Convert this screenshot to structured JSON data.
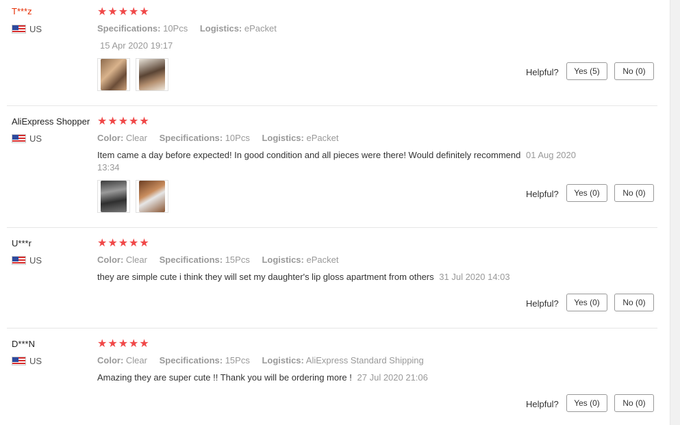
{
  "helpful_label": "Helpful?",
  "star_char": "★",
  "colors": {
    "star": "#f04848",
    "username_highlight": "#e62e04",
    "muted": "#999999"
  },
  "reviews": [
    {
      "user": "T***z",
      "country": "US",
      "rating": 5,
      "specs": [
        {
          "key": "Specifications:",
          "value": "10Pcs"
        },
        {
          "key": "Logistics:",
          "value": "ePacket"
        }
      ],
      "feedback": "",
      "date": "15 Apr 2020 19:17",
      "photos": [
        "photo",
        "photo"
      ],
      "yes": "Yes (5)",
      "no": "No (0)"
    },
    {
      "user": "AliExpress Shopper",
      "country": "US",
      "rating": 5,
      "specs": [
        {
          "key": "Color:",
          "value": "Clear"
        },
        {
          "key": "Specifications:",
          "value": "10Pcs"
        },
        {
          "key": "Logistics:",
          "value": "ePacket"
        }
      ],
      "feedback": "Item came a day before expected! In good condition and all pieces were there! Would definitely recommend",
      "date": "01 Aug 2020 13:34",
      "photos": [
        "photo",
        "photo"
      ],
      "yes": "Yes (0)",
      "no": "No (0)"
    },
    {
      "user": "U***r",
      "country": "US",
      "rating": 5,
      "specs": [
        {
          "key": "Color:",
          "value": "Clear"
        },
        {
          "key": "Specifications:",
          "value": "15Pcs"
        },
        {
          "key": "Logistics:",
          "value": "ePacket"
        }
      ],
      "feedback": "they are simple cute i think they will set my daughter's lip gloss apartment from others",
      "date": "31 Jul 2020 14:03",
      "photos": [],
      "yes": "Yes (0)",
      "no": "No (0)"
    },
    {
      "user": "D***N",
      "country": "US",
      "rating": 5,
      "specs": [
        {
          "key": "Color:",
          "value": "Clear"
        },
        {
          "key": "Specifications:",
          "value": "15Pcs"
        },
        {
          "key": "Logistics:",
          "value": "AliExpress Standard Shipping"
        }
      ],
      "feedback": "Amazing they are super cute !! Thank you will be ordering more !",
      "date": "27 Jul 2020 21:06",
      "photos": [],
      "yes": "Yes (0)",
      "no": "No (0)"
    }
  ]
}
